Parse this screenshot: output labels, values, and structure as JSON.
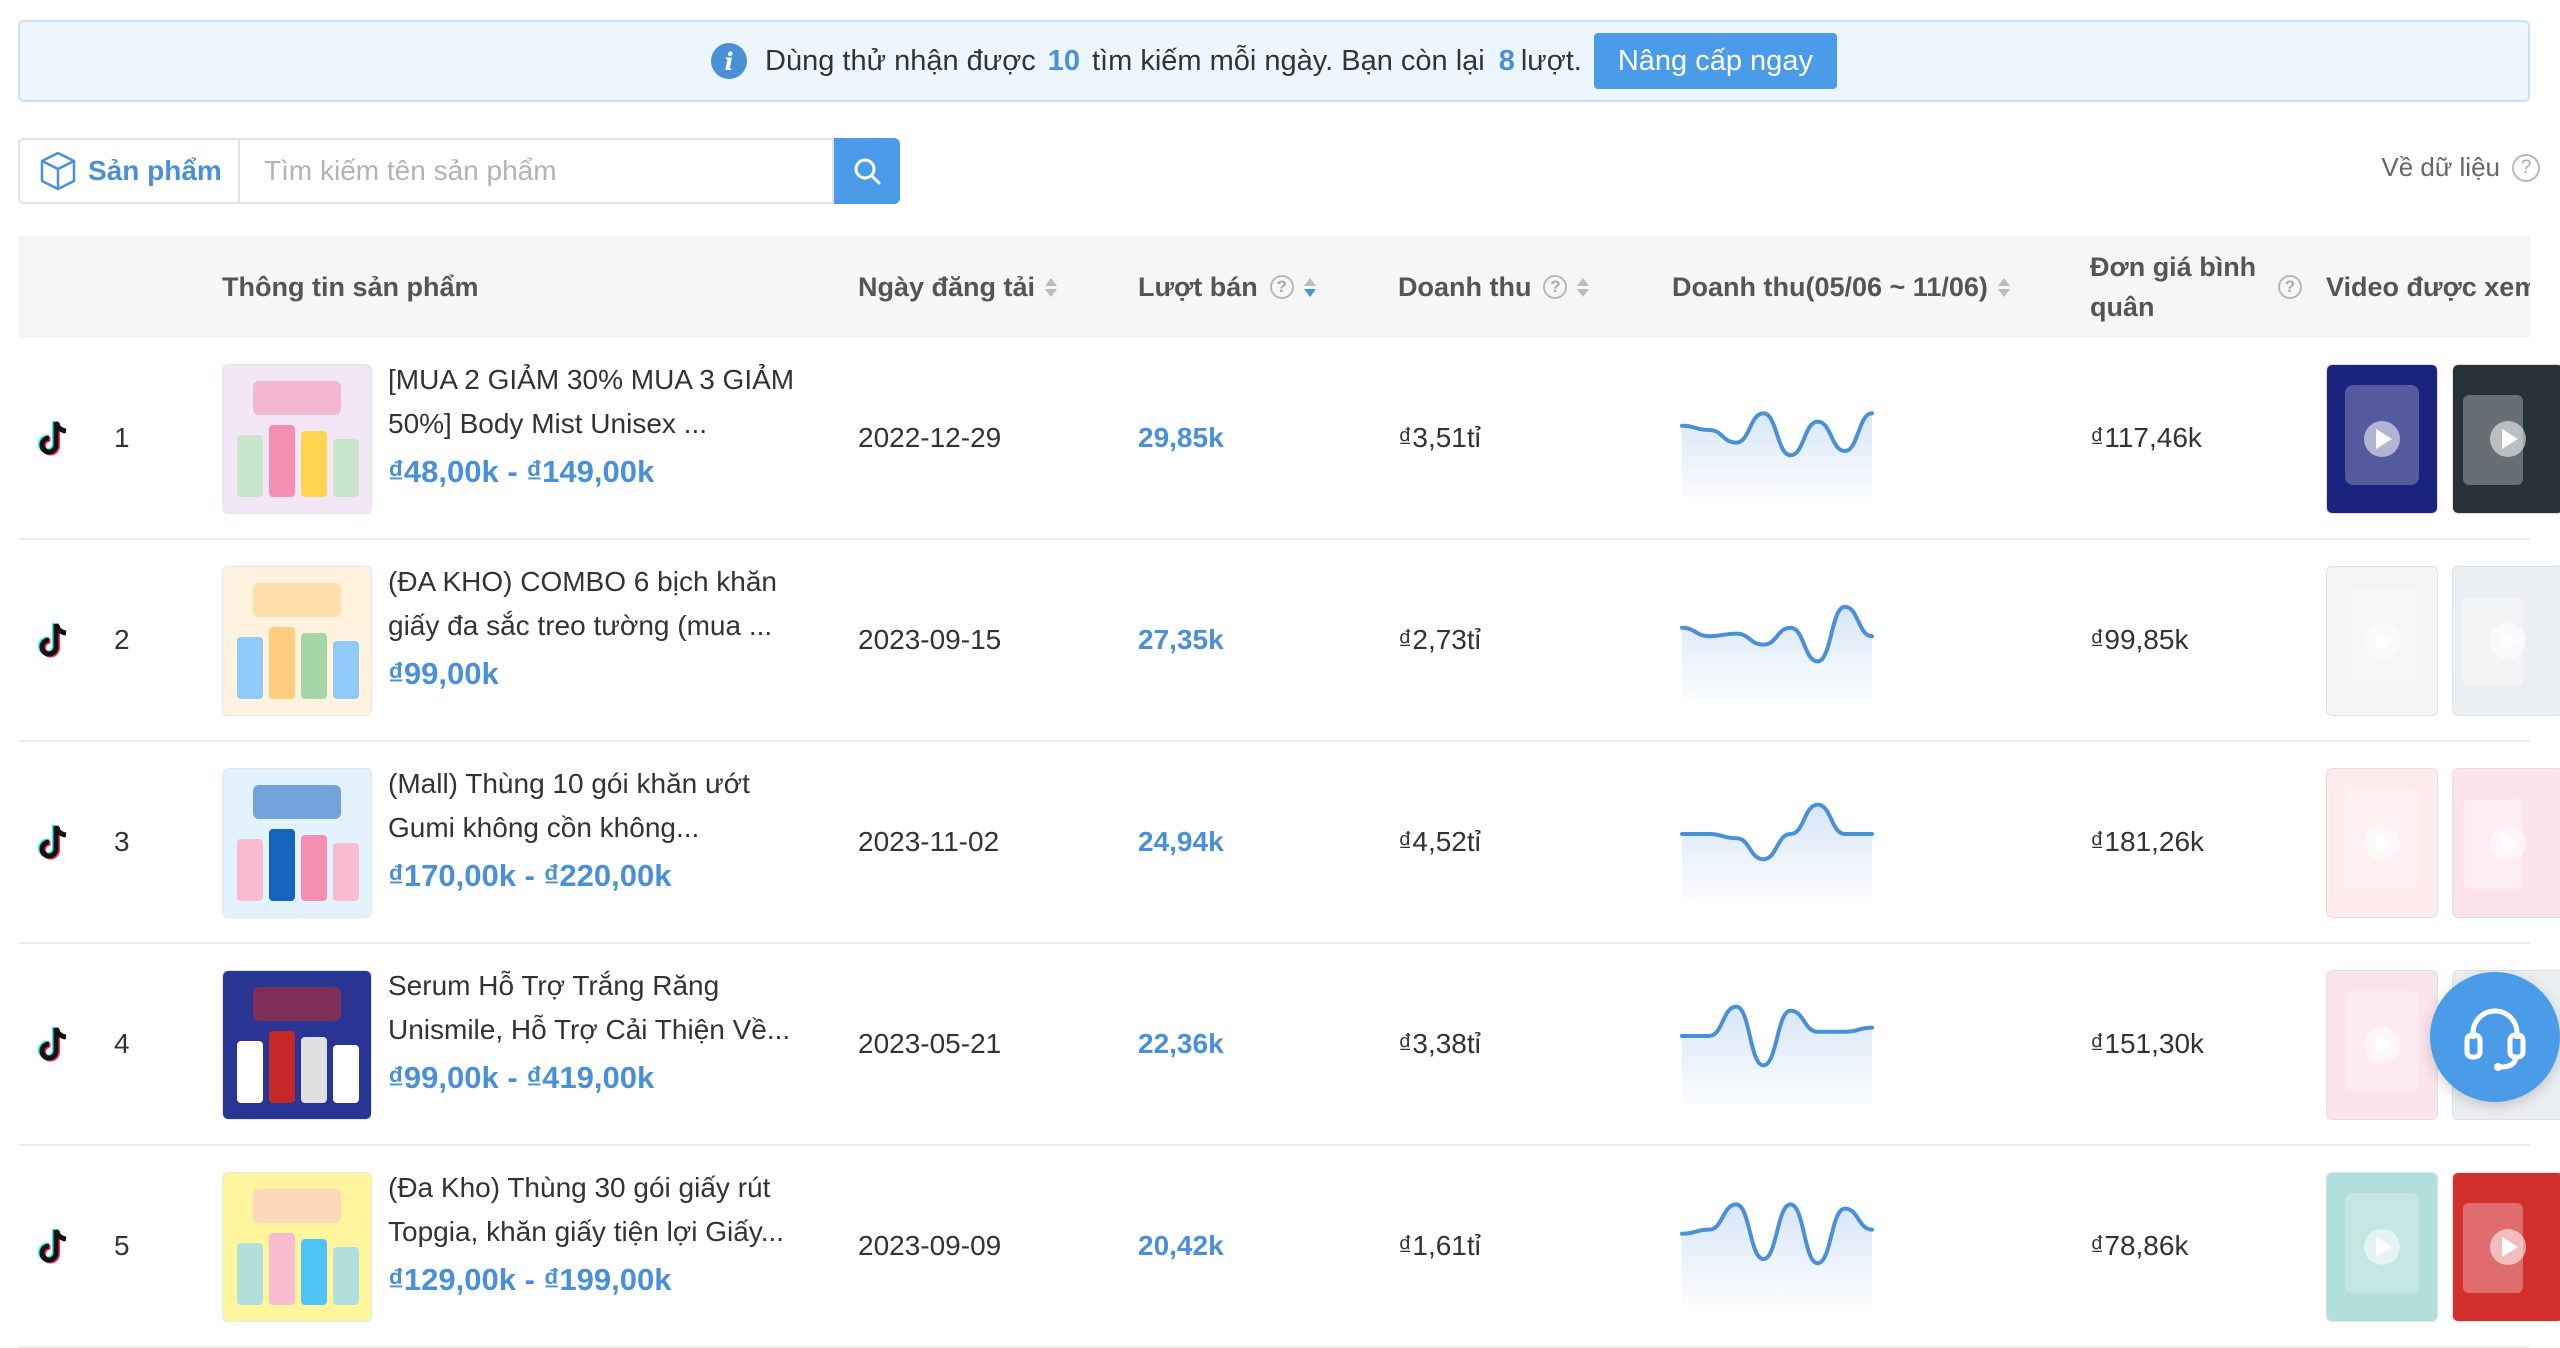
{
  "banner": {
    "text_before": "Dùng thử nhận được",
    "daily_limit": "10",
    "text_middle": "tìm kiếm mỗi ngày. Bạn còn lại",
    "remaining": "8",
    "text_after": "lượt.",
    "upgrade_label": "Nâng cấp ngay"
  },
  "search": {
    "category_label": "Sản phẩm",
    "placeholder": "Tìm kiếm tên sản phẩm",
    "value": ""
  },
  "data_link_label": "Về dữ liệu",
  "table": {
    "columns": {
      "product_info": "Thông tin sản phẩm",
      "upload_date": "Ngày đăng tải",
      "sales": "Lượt bán",
      "revenue": "Doanh thu",
      "revenue_period": "Doanh thu(05/06 ~ 11/06)",
      "avg_price": "Đơn giá bình quân",
      "videos": "Video được xem nhiều"
    },
    "rows": [
      {
        "rank": "1",
        "name": "[MUA 2 GIẢM 30% MUA 3 GIẢM 50%] Body Mist Unisex ...",
        "price": "₫48,00k - ₫149,00k",
        "date": "2022-12-29",
        "sales": "29,85k",
        "revenue": "₫3,51tỉ",
        "trend": [
          0.55,
          0.5,
          0.35,
          0.7,
          0.2,
          0.6,
          0.25,
          0.7
        ],
        "avg_price": "₫117,46k"
      },
      {
        "rank": "2",
        "name": "(ĐA KHO) COMBO 6 bịch khăn giấy đa sắc treo tường (mua ...",
        "price": "₫99,00k",
        "date": "2023-09-15",
        "sales": "27,35k",
        "revenue": "₫2,73tỉ",
        "trend": [
          0.55,
          0.45,
          0.48,
          0.35,
          0.55,
          0.15,
          0.8,
          0.45
        ],
        "avg_price": "₫99,85k"
      },
      {
        "rank": "3",
        "name": "(Mall) Thùng 10 gói khăn ướt Gumi không cồn không...",
        "price": "₫170,00k - ₫220,00k",
        "date": "2023-11-02",
        "sales": "24,94k",
        "revenue": "₫4,52tỉ",
        "trend": [
          0.5,
          0.5,
          0.45,
          0.2,
          0.5,
          0.85,
          0.5,
          0.5
        ],
        "avg_price": "₫181,26k"
      },
      {
        "rank": "4",
        "name": "Serum Hỗ Trợ Trắng Răng Unismile, Hỗ Trợ Cải Thiện Về...",
        "price": "₫99,00k - ₫419,00k",
        "date": "2023-05-21",
        "sales": "22,36k",
        "revenue": "₫3,38tỉ",
        "trend": [
          0.5,
          0.5,
          0.85,
          0.15,
          0.8,
          0.55,
          0.55,
          0.6
        ],
        "avg_price": "₫151,30k"
      },
      {
        "rank": "5",
        "name": "(Đa Kho) Thùng 30 gói giấy rút Topgia, khăn giấy tiện lợi Giấy...",
        "price": "₫129,00k - ₫199,00k",
        "date": "2023-09-09",
        "sales": "20,42k",
        "revenue": "₫1,61tỉ",
        "trend": [
          0.55,
          0.6,
          0.9,
          0.25,
          0.9,
          0.2,
          0.85,
          0.6
        ],
        "avg_price": "₫78,86k"
      }
    ]
  },
  "colors": {
    "accent": "#4a90d9",
    "button": "#4a9ce8",
    "banner_bg": "#eef6fd",
    "header_bg": "#f5f6f8"
  },
  "icons": [
    "info-icon",
    "cube-icon",
    "search-icon",
    "help-icon",
    "sort-icon",
    "tiktok-icon",
    "play-icon",
    "headset-icon"
  ]
}
